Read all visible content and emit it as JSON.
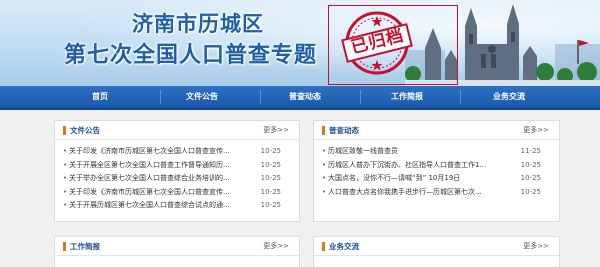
{
  "banner": {
    "title_line1": "济南市历城区",
    "title_line2": "第七次全国人口普查专题",
    "stamp_text": "已归档",
    "accent_color": "#1f5fa8",
    "stamp_color": "#c8102e"
  },
  "nav": {
    "items": [
      {
        "label": "首页"
      },
      {
        "label": "文件公告"
      },
      {
        "label": "普查动态"
      },
      {
        "label": "工作简报"
      },
      {
        "label": "业务交流"
      }
    ]
  },
  "panels": {
    "notices": {
      "title": "文件公告",
      "more": "更多>>",
      "items": [
        {
          "text": "关于印发《济南市历城区第七次全国人口普查宣传...",
          "date": "10-25"
        },
        {
          "text": "关于开展全区第七次全国人口普查工作督导通知历...",
          "date": "10-25"
        },
        {
          "text": "关于举办全区第七次全国人口普查综合业务培训的...",
          "date": "10-25"
        },
        {
          "text": "关于印发《济南市历城区第七次全国人口普查宣传...",
          "date": "10-25"
        },
        {
          "text": "关于开展历城区第七次全国人口普查综合试点的通...",
          "date": "10-25"
        }
      ]
    },
    "dynamics": {
      "title": "普查动态",
      "more": "更多>>",
      "items": [
        {
          "text": "历城区致敬一线普查员",
          "date": "11-25"
        },
        {
          "text": "历城区人普办下沉街办、社区指导人口普查工作1...",
          "date": "10-25"
        },
        {
          "text": "大国点名，没你不行—请喊“到” 10月19日",
          "date": "10-25"
        },
        {
          "text": "人口普查大点名你我携手进步行—历城区第七次...",
          "date": "10-25"
        }
      ]
    },
    "briefing": {
      "title": "工作简报",
      "more": "更多>>"
    },
    "exchange": {
      "title": "业务交流",
      "more": "更多>>"
    }
  }
}
